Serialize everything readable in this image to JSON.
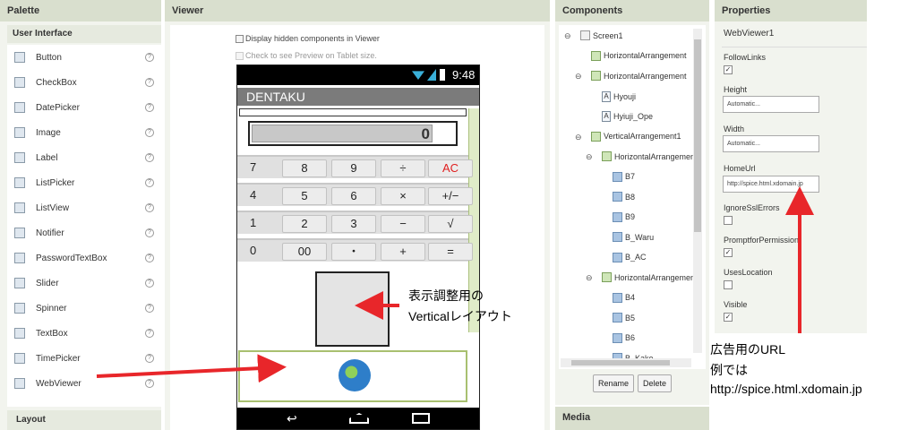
{
  "palette": {
    "title": "Palette",
    "section": "User Interface",
    "items": [
      {
        "label": "Button",
        "icon": "button-icon"
      },
      {
        "label": "CheckBox",
        "icon": "checkbox-icon"
      },
      {
        "label": "DatePicker",
        "icon": "datepicker-icon"
      },
      {
        "label": "Image",
        "icon": "image-icon"
      },
      {
        "label": "Label",
        "icon": "label-icon"
      },
      {
        "label": "ListPicker",
        "icon": "listpicker-icon"
      },
      {
        "label": "ListView",
        "icon": "listview-icon"
      },
      {
        "label": "Notifier",
        "icon": "notifier-icon"
      },
      {
        "label": "PasswordTextBox",
        "icon": "password-icon"
      },
      {
        "label": "Slider",
        "icon": "slider-icon"
      },
      {
        "label": "Spinner",
        "icon": "spinner-icon"
      },
      {
        "label": "TextBox",
        "icon": "textbox-icon"
      },
      {
        "label": "TimePicker",
        "icon": "timepicker-icon"
      },
      {
        "label": "WebViewer",
        "icon": "webviewer-icon"
      }
    ],
    "help": "?",
    "layout_section": "Layout"
  },
  "viewer": {
    "title": "Viewer",
    "show_hidden": "Display hidden components in Viewer",
    "tablet_preview": "Check to see Preview on Tablet size."
  },
  "phone": {
    "time": "9:48",
    "app_title": "DENTAKU",
    "display_value": "0",
    "keys": [
      [
        "7",
        "8",
        "9",
        "÷",
        "AC"
      ],
      [
        "4",
        "5",
        "6",
        "×",
        "+/−"
      ],
      [
        "1",
        "2",
        "3",
        "−",
        "√"
      ],
      [
        "0",
        "00",
        "・",
        "+",
        "="
      ]
    ]
  },
  "components": {
    "title": "Components",
    "tree": [
      {
        "label": "Screen1",
        "level": 0,
        "toggle": "⊖",
        "icon": "screen"
      },
      {
        "label": "HorizontalArrangement",
        "level": 1,
        "toggle": "",
        "icon": "arr"
      },
      {
        "label": "HorizontalArrangement",
        "level": 1,
        "toggle": "⊖",
        "icon": "arr"
      },
      {
        "label": "Hyouji",
        "level": 2,
        "toggle": "",
        "icon": "label"
      },
      {
        "label": "Hyiuji_Ope",
        "level": 2,
        "toggle": "",
        "icon": "label"
      },
      {
        "label": "VerticalArrangement1",
        "level": 1,
        "toggle": "⊖",
        "icon": "varr"
      },
      {
        "label": "HorizontalArrangement",
        "level": 2,
        "toggle": "⊖",
        "icon": "arr"
      },
      {
        "label": "B7",
        "level": 3,
        "toggle": "",
        "icon": "btn"
      },
      {
        "label": "B8",
        "level": 3,
        "toggle": "",
        "icon": "btn"
      },
      {
        "label": "B9",
        "level": 3,
        "toggle": "",
        "icon": "btn"
      },
      {
        "label": "B_Waru",
        "level": 3,
        "toggle": "",
        "icon": "btn"
      },
      {
        "label": "B_AC",
        "level": 3,
        "toggle": "",
        "icon": "btn"
      },
      {
        "label": "HorizontalArrangement",
        "level": 2,
        "toggle": "⊖",
        "icon": "arr"
      },
      {
        "label": "B4",
        "level": 3,
        "toggle": "",
        "icon": "btn"
      },
      {
        "label": "B5",
        "level": 3,
        "toggle": "",
        "icon": "btn"
      },
      {
        "label": "B6",
        "level": 3,
        "toggle": "",
        "icon": "btn"
      },
      {
        "label": "B_Kake",
        "level": 3,
        "toggle": "",
        "icon": "btn"
      }
    ],
    "rename": "Rename",
    "delete": "Delete"
  },
  "media": {
    "title": "Media"
  },
  "properties": {
    "title": "Properties",
    "component": "WebViewer1",
    "follow_links": "FollowLinks",
    "height": "Height",
    "height_value": "Automatic...",
    "width": "Width",
    "width_value": "Automatic...",
    "home_url": "HomeUrl",
    "home_url_value": "http://spice.html.xdomain.jp",
    "ignore_ssl": "IgnoreSslErrors",
    "prompt_permission": "PromptforPermission",
    "uses_location": "UsesLocation",
    "visible": "Visible"
  },
  "annotations": {
    "vertical_line1": "表示調整用の",
    "vertical_line2": "Verticalレイアウト",
    "ad_line1": "広告用のURL",
    "ad_line2": "例では",
    "ad_line3": "http://spice.html.xdomain.jp"
  },
  "colors": {
    "arrow": "#e8262a",
    "panel_header": "#d9dfce",
    "panel_bg": "#f2f4ee"
  }
}
